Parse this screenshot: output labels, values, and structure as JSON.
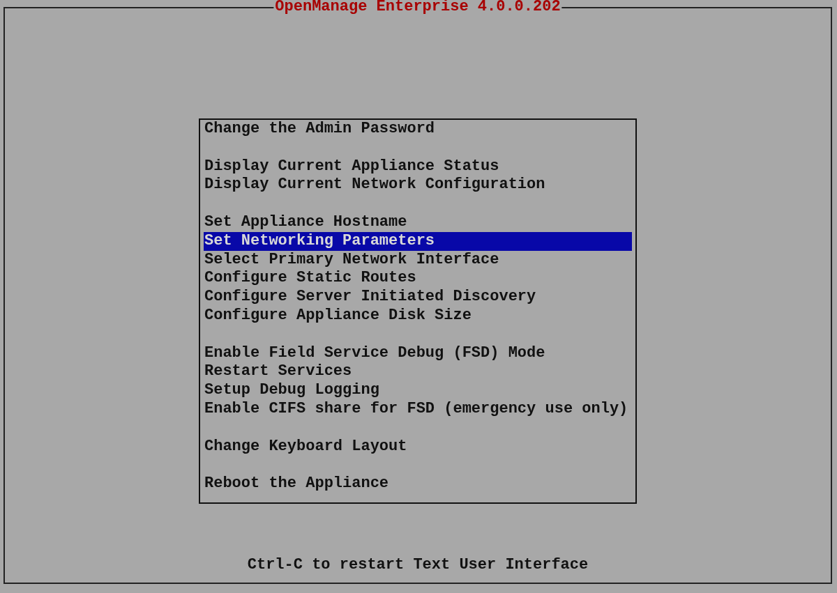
{
  "window": {
    "title": "OpenManage Enterprise 4.0.0.202"
  },
  "menu": {
    "groups": [
      {
        "items": [
          {
            "label": "Change the Admin Password",
            "selected": false
          }
        ]
      },
      {
        "items": [
          {
            "label": "Display Current Appliance Status",
            "selected": false
          },
          {
            "label": "Display Current Network Configuration",
            "selected": false
          }
        ]
      },
      {
        "items": [
          {
            "label": "Set Appliance Hostname",
            "selected": false
          },
          {
            "label": "Set Networking Parameters",
            "selected": true
          },
          {
            "label": "Select Primary Network Interface",
            "selected": false
          },
          {
            "label": "Configure Static Routes",
            "selected": false
          },
          {
            "label": "Configure Server Initiated Discovery",
            "selected": false
          },
          {
            "label": "Configure Appliance Disk Size",
            "selected": false
          }
        ]
      },
      {
        "items": [
          {
            "label": "Enable Field Service Debug (FSD) Mode",
            "selected": false
          },
          {
            "label": "Restart Services",
            "selected": false
          },
          {
            "label": "Setup Debug Logging",
            "selected": false
          },
          {
            "label": "Enable CIFS share for FSD (emergency use only)",
            "selected": false
          }
        ]
      },
      {
        "items": [
          {
            "label": "Change Keyboard Layout",
            "selected": false
          }
        ]
      },
      {
        "items": [
          {
            "label": "Reboot the Appliance",
            "selected": false
          }
        ]
      }
    ]
  },
  "status_bar": {
    "hint": "Ctrl-C to restart Text User Interface"
  }
}
